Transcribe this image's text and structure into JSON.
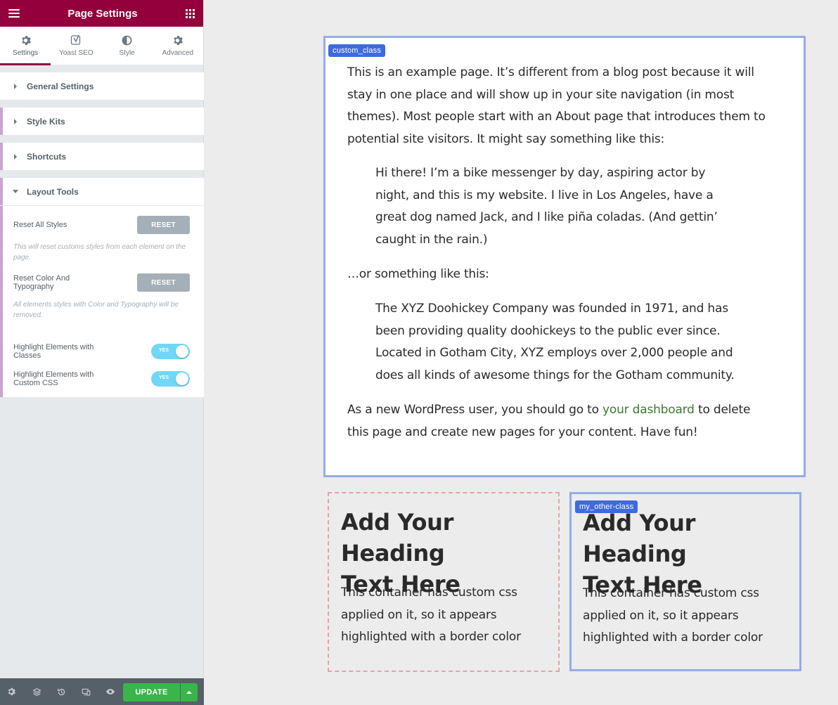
{
  "panel": {
    "title": "Page Settings",
    "tabs": [
      {
        "label": "Settings",
        "icon": "gear-icon",
        "active": true
      },
      {
        "label": "Yoast SEO",
        "icon": "yoast-icon",
        "active": false
      },
      {
        "label": "Style",
        "icon": "half-circle-icon",
        "active": false
      },
      {
        "label": "Advanced",
        "icon": "gear-icon",
        "active": false
      }
    ],
    "sections": {
      "general": "General Settings",
      "style_kits": "Style Kits",
      "shortcuts": "Shortcuts",
      "layout_tools": "Layout Tools"
    },
    "layout_tools": {
      "reset_all_label": "Reset All Styles",
      "reset_all_button": "RESET",
      "reset_all_desc": "This will reset customs styles from each element on the page.",
      "reset_color_label_1": "Reset Color And",
      "reset_color_label_2": "Typography",
      "reset_color_button": "RESET",
      "reset_color_desc": "All elements styles with Color and Typography will be removed.",
      "highlight_classes_1": "Highlight Elements with",
      "highlight_classes_2": "Classes",
      "highlight_classes_toggle": "YES",
      "highlight_css_1": "Highlight Elements with",
      "highlight_css_2": "Custom CSS",
      "highlight_css_toggle": "YES"
    },
    "footer": {
      "update_label": "UPDATE"
    }
  },
  "canvas": {
    "main_badge": "custom_class",
    "p1": [
      "This is an example page. It’s different from a blog post because it will",
      "stay in one place and will show up in your site navigation (in most",
      "themes). Most people start with an About page that introduces them to",
      "potential site visitors. It might say something like this:"
    ],
    "quote1": [
      "Hi there! I’m a bike messenger by day, aspiring actor by",
      "night, and this is my website. I live in Los Angeles, have a",
      "great dog named Jack, and I like piña coladas. (And gettin’",
      "caught in the rain.)"
    ],
    "p2": "…or something like this:",
    "quote2": [
      "The XYZ Doohickey Company was founded in 1971, and has",
      "been providing quality doohickeys to the public ever since.",
      "Located in Gotham City, XYZ employs over 2,000 people and",
      "does all kinds of awesome things for the Gotham community."
    ],
    "p3_before": "As a new WordPress user, you should go to ",
    "p3_link": "your dashboard",
    "p3_after": " to delete",
    "p3_line2": "this page and create new pages for your content. Have fun!",
    "left_box": {
      "heading_1": "Add Your Heading",
      "heading_2": "Text Here",
      "text": [
        "This container has custom css",
        "applied on it, so it appears",
        "highlighted with a border color"
      ]
    },
    "right_box": {
      "badge": "my_other-class",
      "heading_1": "Add Your Heading",
      "heading_2": "Text Here",
      "text": [
        "This container has custom css",
        "applied on it, so it appears",
        "highlighted with a border color"
      ]
    }
  },
  "colors": {
    "brand": "#93003c",
    "highlight_border": "#96abe8",
    "dashed_border": "#e8a1a7",
    "badge": "#3e6ae0",
    "update": "#39b54a",
    "toggle_on": "#71d7f7",
    "link": "#3b7a2e"
  }
}
